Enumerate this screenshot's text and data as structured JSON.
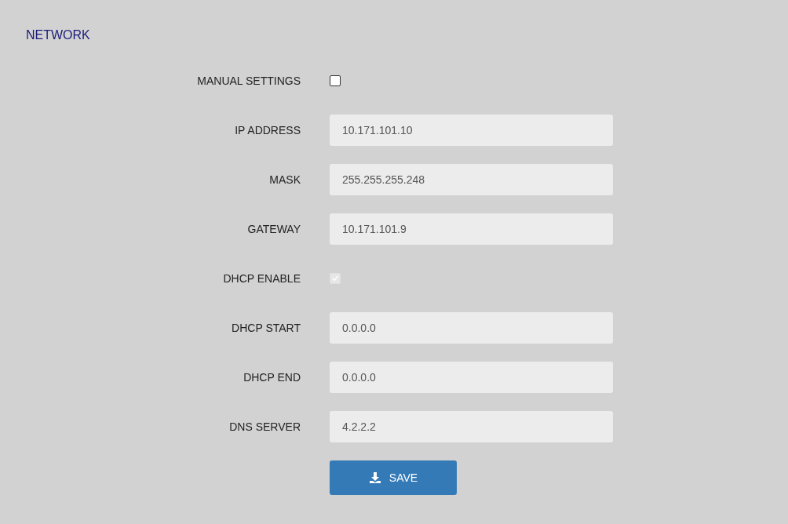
{
  "title": "NETWORK",
  "fields": [
    {
      "kind": "checkbox",
      "label": "MANUAL SETTINGS",
      "checked": false,
      "disabled": false
    },
    {
      "kind": "text",
      "label": "IP ADDRESS",
      "value": "10.171.101.10"
    },
    {
      "kind": "text",
      "label": "MASK",
      "value": "255.255.255.248"
    },
    {
      "kind": "text",
      "label": "GATEWAY",
      "value": "10.171.101.9"
    },
    {
      "kind": "checkbox",
      "label": "DHCP ENABLE",
      "checked": true,
      "disabled": true
    },
    {
      "kind": "text",
      "label": "DHCP START",
      "value": "0.0.0.0"
    },
    {
      "kind": "text",
      "label": "DHCP END",
      "value": "0.0.0.0"
    },
    {
      "kind": "text",
      "label": "DNS SERVER",
      "value": "4.2.2.2"
    }
  ],
  "save_button": {
    "label": "SAVE"
  }
}
